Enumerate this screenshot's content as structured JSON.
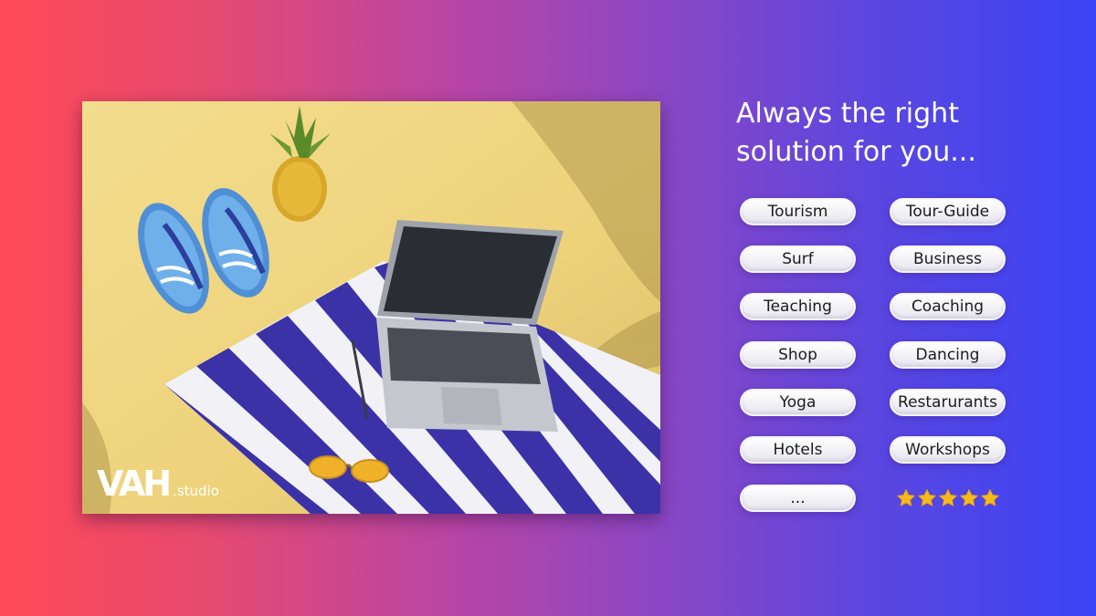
{
  "logo": {
    "mark": "VAH",
    "sub": ".studio"
  },
  "headline": {
    "line1": "Always the right",
    "line2": "solution for you..."
  },
  "tags": {
    "left": [
      "Tourism",
      "Surf",
      "Teaching",
      "Shop",
      "Yoga",
      "Hotels",
      "..."
    ],
    "right": [
      "Tour-Guide",
      "Business",
      "Coaching",
      "Dancing",
      "Restarurants",
      "Workshops"
    ]
  },
  "rating": {
    "stars": 5,
    "max": 5,
    "color": "#f7b81b",
    "icon": "star-icon"
  },
  "colors": {
    "gradient_start": "#ff4a57",
    "gradient_end": "#3a44f5",
    "stripe": "#3b32a8"
  }
}
